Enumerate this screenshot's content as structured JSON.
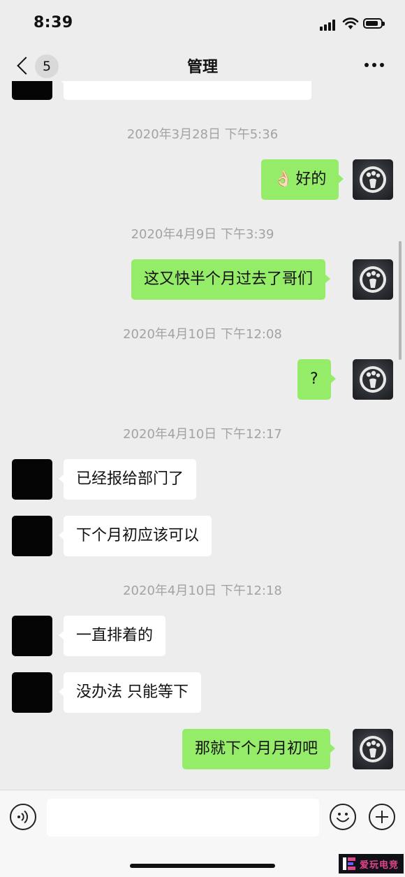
{
  "status_bar": {
    "time": "8:39"
  },
  "nav": {
    "back_count": "5",
    "title": "管理"
  },
  "messages": [
    {
      "type": "timestamp",
      "text": "2020年3月28日 下午5:36"
    },
    {
      "type": "sent",
      "emoji": "👌🏻",
      "text": "好的"
    },
    {
      "type": "timestamp",
      "text": "2020年4月9日 下午3:39"
    },
    {
      "type": "sent",
      "text": "这又快半个月过去了哥们"
    },
    {
      "type": "timestamp",
      "text": "2020年4月10日 下午12:08"
    },
    {
      "type": "sent",
      "text": "?"
    },
    {
      "type": "timestamp",
      "text": "2020年4月10日 下午12:17"
    },
    {
      "type": "received",
      "text": "已经报给部门了"
    },
    {
      "type": "received",
      "text": "下个月初应该可以"
    },
    {
      "type": "timestamp",
      "text": "2020年4月10日 下午12:18"
    },
    {
      "type": "received",
      "text": "一直排着的"
    },
    {
      "type": "received",
      "text": "没办法 只能等下"
    },
    {
      "type": "sent",
      "text": "那就下个月月初吧"
    }
  ],
  "input": {
    "value": "",
    "placeholder": ""
  },
  "watermark": {
    "text": "爱玩电竞"
  },
  "colors": {
    "sent_bubble": "#95ec69",
    "received_bubble": "#ffffff",
    "background": "#ededed"
  }
}
